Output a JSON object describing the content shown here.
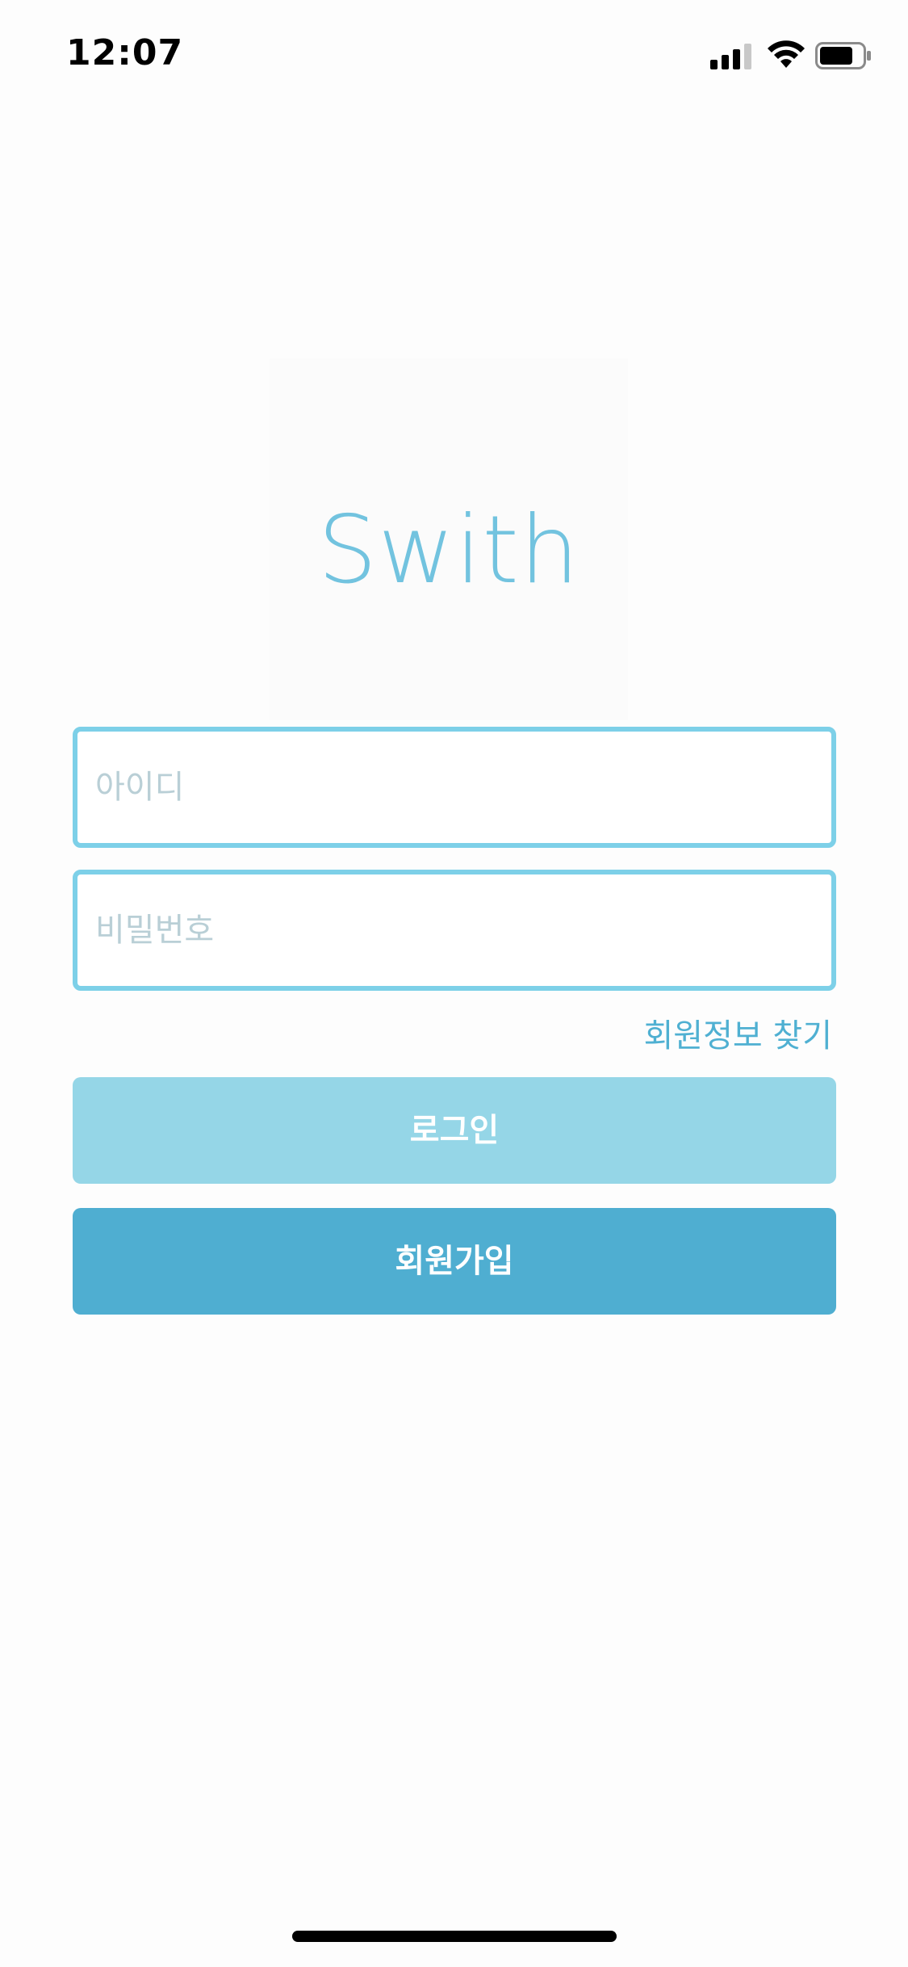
{
  "status_bar": {
    "time": "12:07",
    "signal_icon": "cellular-signal-icon",
    "wifi_icon": "wifi-icon",
    "battery_icon": "battery-icon"
  },
  "logo": {
    "text": "Swith",
    "color": "#72c3df"
  },
  "login_form": {
    "id_placeholder": "아이디",
    "id_value": "",
    "password_placeholder": "비밀번호",
    "password_value": "",
    "find_account_label": "회원정보 찾기",
    "login_label": "로그인",
    "signup_label": "회원가입"
  },
  "colors": {
    "field_border": "#7dd0e8",
    "login_button": "#95d6e7",
    "signup_button": "#4faed1",
    "link": "#4fb0d2"
  }
}
